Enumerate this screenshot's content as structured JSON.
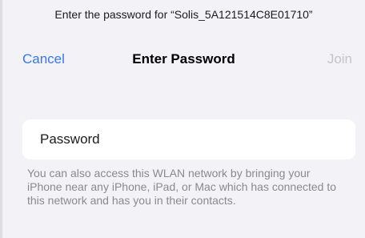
{
  "prompt": "Enter the password for “Solis_5A121514C8E01710”",
  "nav": {
    "cancel_label": "Cancel",
    "title": "Enter Password",
    "join_label": "Join"
  },
  "password_field": {
    "placeholder": "Password",
    "value": ""
  },
  "footnote": "You can also access this WLAN network by bringing your iPhone near any iPhone, iPad, or Mac which has connected to this network and has you in their contacts.",
  "colors": {
    "accent": "#3478f6",
    "disabled": "#c4c4c9",
    "background": "#f2f2f7",
    "secondary_text": "#8a8a8e"
  }
}
